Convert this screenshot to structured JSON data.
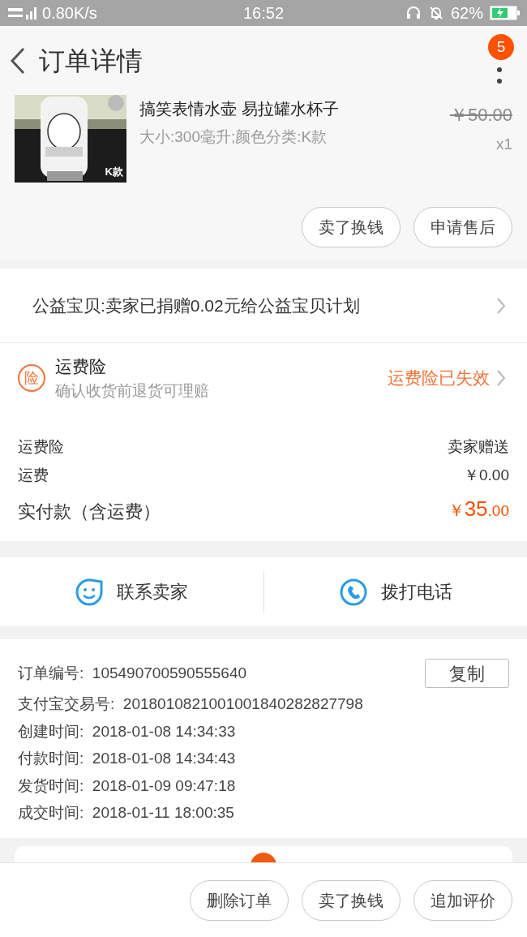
{
  "status_bar": {
    "network": "0.80K/s",
    "time": "16:52",
    "battery": "62%"
  },
  "header": {
    "title": "订单详情",
    "badge": "5"
  },
  "product": {
    "image_label": "K款",
    "name": "搞笑表情水壶 易拉罐水杯子",
    "spec": "大小:300毫升;颜色分类:K款",
    "original_price": "￥50.00",
    "quantity": "x1"
  },
  "product_actions": [
    "卖了换钱",
    "申请售后"
  ],
  "charity": {
    "text": "公益宝贝:卖家已捐赠0.02元给公益宝贝计划"
  },
  "insurance": {
    "icon_text": "险",
    "title": "运费险",
    "subtitle": "确认收货前退货可理赔",
    "status": "运费险已失效"
  },
  "fees": [
    {
      "label": "运费险",
      "value": "卖家赠送"
    },
    {
      "label": "运费",
      "value": "￥0.00"
    }
  ],
  "total": {
    "label": "实付款（含运费）",
    "currency": "￥",
    "integer": "35",
    "decimal": ".00"
  },
  "contact": [
    {
      "kind": "chat",
      "label": "联系卖家"
    },
    {
      "kind": "phone",
      "label": "拨打电话"
    }
  ],
  "order_info": {
    "order_number_label": "订单编号:",
    "order_number": "105490700590555640",
    "copy_button": "复制",
    "rows": [
      {
        "label": "支付宝交易号:",
        "value": "2018010821001001840282827798"
      },
      {
        "label": "创建时间:",
        "value": "2018-01-08 14:34:33"
      },
      {
        "label": "付款时间:",
        "value": "2018-01-08 14:34:43"
      },
      {
        "label": "发货时间:",
        "value": "2018-01-09 09:47:18"
      },
      {
        "label": "成交时间:",
        "value": "2018-01-11 18:00:35"
      }
    ]
  },
  "bottom_actions": [
    "删除订单",
    "卖了换钱",
    "追加评价"
  ]
}
